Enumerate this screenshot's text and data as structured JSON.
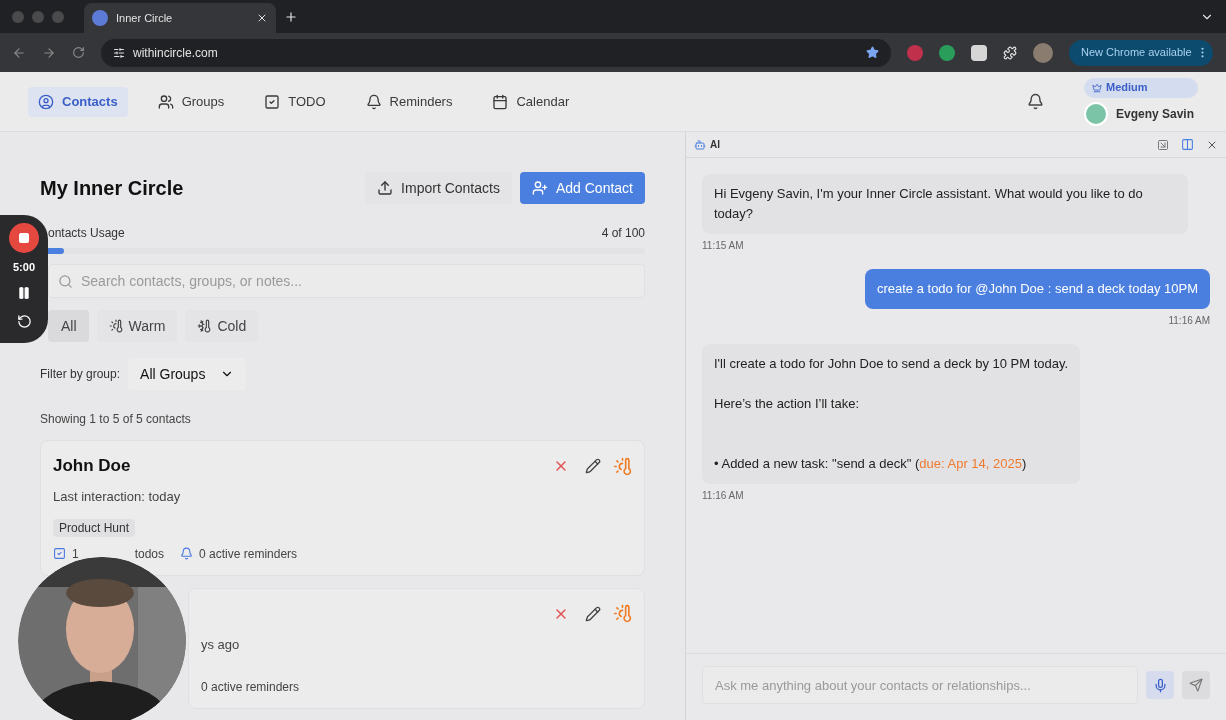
{
  "browser": {
    "tab_title": "Inner Circle",
    "url": "withincircle.com",
    "update_button": "New Chrome available"
  },
  "nav": {
    "items": [
      {
        "kind": "contacts",
        "label": "Contacts",
        "selected": true
      },
      {
        "kind": "groups",
        "label": "Groups",
        "selected": false
      },
      {
        "kind": "todo",
        "label": "TODO",
        "selected": false
      },
      {
        "kind": "reminders",
        "label": "Reminders",
        "selected": false
      },
      {
        "kind": "calendar",
        "label": "Calendar",
        "selected": false
      }
    ],
    "plan_badge": "Medium",
    "user_name": "Evgeny Savin"
  },
  "recorder": {
    "time": "5:00"
  },
  "contacts": {
    "title": "My Inner Circle",
    "import_button": "Import Contacts",
    "add_button": "Add Contact",
    "usage": {
      "label": "ontacts Usage",
      "reading": "4 of 100",
      "level": 0.04
    },
    "search": {
      "placeholder": "Search contacts, groups, or notes..."
    },
    "filters": [
      {
        "kind": "all",
        "label": "All",
        "selected": true
      },
      {
        "kind": "warm",
        "label": "Warm",
        "selected": false
      },
      {
        "kind": "cold",
        "label": "Cold",
        "selected": false
      }
    ],
    "group_filter": {
      "label": "Filter by group:",
      "value": "All Groups"
    },
    "showing": "Showing 1 to 5 of 5 contacts",
    "cards": [
      {
        "name": "John Doe",
        "last_interaction": "Last interaction: today",
        "tag": "Product Hunt",
        "todos_count": "1",
        "todos_label": "todos",
        "reminders": "0 active reminders"
      },
      {
        "last_interaction": "ys ago",
        "reminders": "0 active reminders"
      }
    ]
  },
  "chat": {
    "title": "AI",
    "placeholder": "Ask me anything about your contacts or relationships...",
    "messages": [
      {
        "kind": "assistant",
        "paragraphs": [
          "Hi Evgeny Savin, I'm your Inner Circle assistant. What would you like to do today?"
        ],
        "time": "11:15 AM"
      },
      {
        "kind": "user",
        "paragraphs": [
          "create a todo for @John Doe : send a deck today 10PM"
        ],
        "time": "11:16 AM"
      },
      {
        "kind": "assistant",
        "paragraphs": [
          "I'll create a todo for John Doe to send a deck by 10 PM today.",
          "Here’s the action I’ll take:"
        ],
        "bullet": {
          "mark": "•",
          "text": "Added a new task: \"send a deck\" (",
          "due": "due: Apr 14, 2025",
          "end": ")"
        },
        "time": "11:16 AM"
      }
    ]
  }
}
